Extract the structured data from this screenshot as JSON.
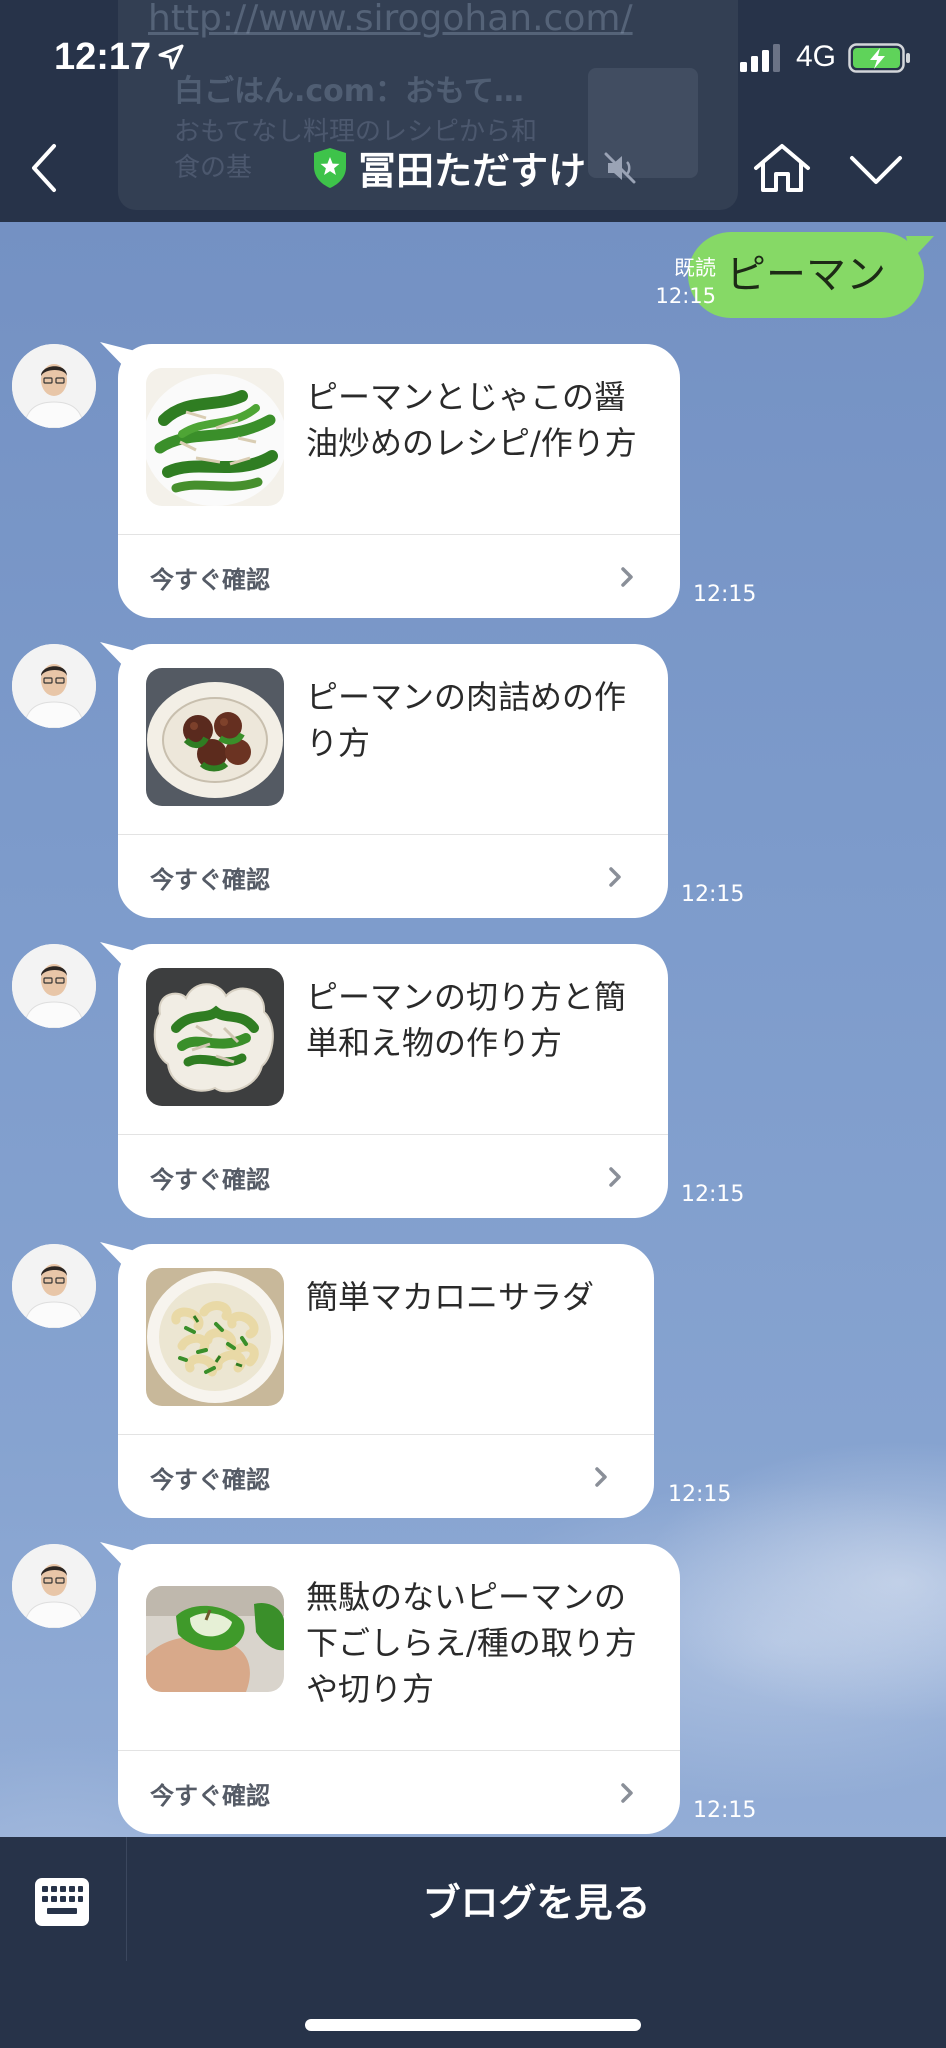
{
  "status_bar": {
    "time": "12:17",
    "network": "4G"
  },
  "header": {
    "contact_name": "冨田ただすけ",
    "background_preview": {
      "url": "http://www.sirogohan.com/",
      "title": "白ごはん.com：おもて…",
      "description": "おもてなし料理のレシピから和食の基"
    }
  },
  "messages": {
    "outgoing": {
      "text": "ピーマン",
      "read_label": "既読",
      "time": "12:15"
    },
    "cards": [
      {
        "title": "ピーマンとじゃこの醤油炒めのレシピ/作り方",
        "action": "今すぐ確認",
        "time": "12:15",
        "image": "green peppers and small sardines stir-fry"
      },
      {
        "title": "ピーマンの肉詰めの作り方",
        "action": "今すぐ確認",
        "time": "12:15",
        "image": "stuffed peppers in a bowl"
      },
      {
        "title": "ピーマンの切り方と簡単和え物の作り方",
        "action": "今すぐ確認",
        "time": "12:15",
        "image": "pepper aemono in a flower bowl"
      },
      {
        "title": "簡単マカロニサラダ",
        "action": "今すぐ確認",
        "time": "12:15",
        "image": "macaroni salad"
      },
      {
        "title": "無駄のないピーマンの下ごしらえ/種の取り方や切り方",
        "action": "今すぐ確認",
        "time": "12:15",
        "image": "hand holding halved green pepper"
      }
    ]
  },
  "bottom_bar": {
    "button_label": "ブログを見る"
  },
  "colors": {
    "header_bg": "#273349",
    "outgoing_bubble": "#86d966",
    "chat_bg": "#7f9cc9",
    "official_badge": "#3ec34a"
  },
  "icons": {
    "back": "chevron-left-icon",
    "official": "shield-star-icon",
    "mute": "speaker-mute-icon",
    "home": "home-icon",
    "menu": "chevron-down-icon",
    "keyboard": "keyboard-icon"
  }
}
